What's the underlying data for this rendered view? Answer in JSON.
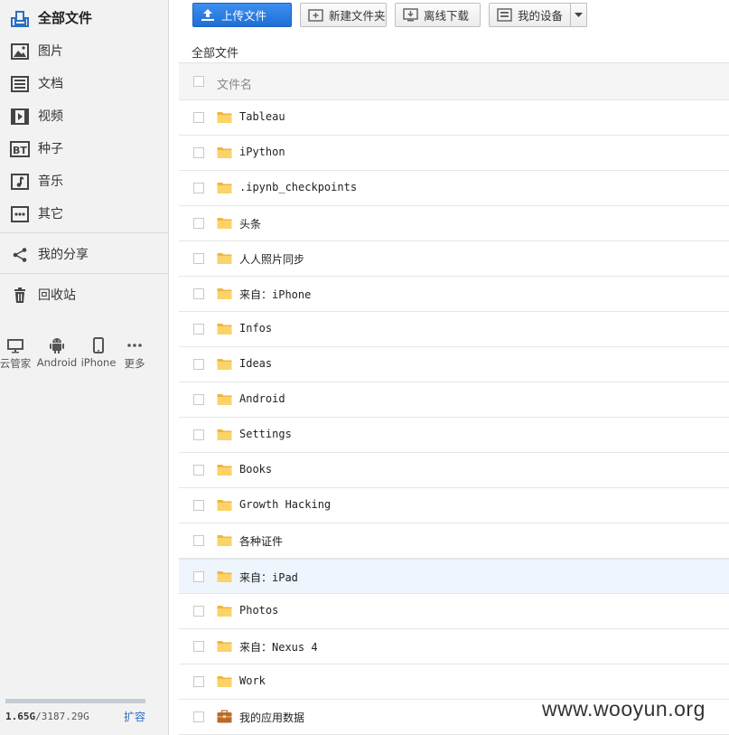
{
  "sidebar": {
    "nav": [
      {
        "label": "全部文件",
        "icon": "all-files-icon"
      },
      {
        "label": "图片",
        "icon": "image-icon"
      },
      {
        "label": "文档",
        "icon": "document-icon"
      },
      {
        "label": "视频",
        "icon": "video-icon"
      },
      {
        "label": "种子",
        "icon": "bt-icon"
      },
      {
        "label": "音乐",
        "icon": "music-icon"
      },
      {
        "label": "其它",
        "icon": "more-icon"
      }
    ],
    "share": {
      "label": "我的分享",
      "icon": "share-icon"
    },
    "recycle": {
      "label": "回收站",
      "icon": "trash-icon"
    },
    "devices": [
      {
        "label": "云管家",
        "icon": "desktop-icon"
      },
      {
        "label": "Android",
        "icon": "android-icon"
      },
      {
        "label": "iPhone",
        "icon": "phone-icon"
      },
      {
        "label": "更多",
        "icon": "ellipsis-icon"
      }
    ],
    "quota": {
      "used": "1.65G",
      "total": "/3187.29G",
      "expand": "扩容",
      "used_fraction": 0.0005
    }
  },
  "toolbar": {
    "upload": "上传文件",
    "new_folder": "新建文件夹",
    "offline": "离线下载",
    "my_devices": "我的设备"
  },
  "breadcrumb": "全部文件",
  "list": {
    "header": "文件名",
    "files": [
      {
        "name": "Tableau",
        "type": "folder"
      },
      {
        "name": "iPython",
        "type": "folder"
      },
      {
        "name": ".ipynb_checkpoints",
        "type": "folder"
      },
      {
        "name": "头条",
        "type": "folder"
      },
      {
        "name": "人人照片同步",
        "type": "folder"
      },
      {
        "name": "来自：iPhone",
        "type": "folder"
      },
      {
        "name": "Infos",
        "type": "folder"
      },
      {
        "name": "Ideas",
        "type": "folder"
      },
      {
        "name": "Android",
        "type": "folder"
      },
      {
        "name": "Settings",
        "type": "folder"
      },
      {
        "name": "Books",
        "type": "folder"
      },
      {
        "name": "Growth Hacking",
        "type": "folder"
      },
      {
        "name": "各种证件",
        "type": "folder"
      },
      {
        "name": "来自：iPad",
        "type": "folder",
        "highlighted": true
      },
      {
        "name": "Photos",
        "type": "folder"
      },
      {
        "name": "来自：Nexus 4",
        "type": "folder"
      },
      {
        "name": "Work",
        "type": "folder"
      },
      {
        "name": "我的应用数据",
        "type": "app-folder"
      }
    ]
  },
  "watermark": "www.wooyun.org",
  "colors": {
    "accent": "#1f6fd4",
    "folder": "#f5c242",
    "highlight": "#eef5fd"
  }
}
